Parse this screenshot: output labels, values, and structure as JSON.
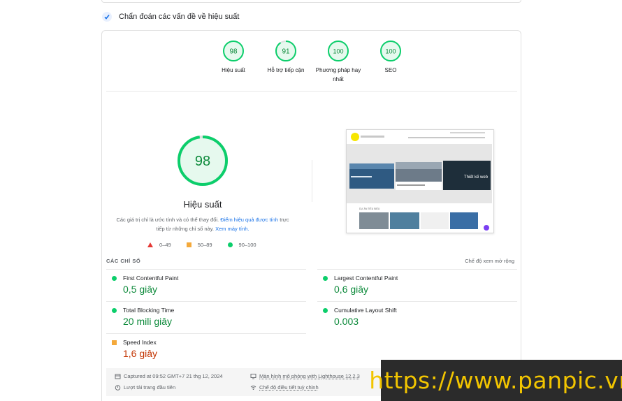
{
  "section": {
    "title": "Chẩn đoán các vấn đề về hiệu suất",
    "icon": "speed-check-icon"
  },
  "gauges": [
    {
      "score": "98",
      "label": "Hiệu suất"
    },
    {
      "score": "91",
      "label": "Hỗ trợ tiếp cận"
    },
    {
      "score": "100",
      "label": "Phương pháp hay nhất"
    },
    {
      "score": "100",
      "label": "SEO"
    }
  ],
  "performance": {
    "score": "98",
    "title": "Hiệu suất",
    "note_before": "Các giá trị chỉ là ước tính và có thể thay đổi. ",
    "note_link1": "Điểm hiệu quả được tính",
    "note_middle": " trực tiếp từ những chỉ số này. ",
    "note_link2": "Xem máy tính."
  },
  "legend": {
    "fail": "0–49",
    "average": "50–89",
    "pass": "90–100"
  },
  "metrics": {
    "title": "CÁC CHỈ SỐ",
    "toggle": "Chế độ xem mở rộng",
    "items": [
      {
        "name": "First Contentful Paint",
        "value": "0,5 giây",
        "status": "green"
      },
      {
        "name": "Largest Contentful Paint",
        "value": "0,6 giây",
        "status": "green"
      },
      {
        "name": "Total Blocking Time",
        "value": "20 mili giây",
        "status": "green"
      },
      {
        "name": "Cumulative Layout Shift",
        "value": "0.003",
        "status": "green"
      },
      {
        "name": "Speed Index",
        "value": "1,6 giây",
        "status": "orange"
      }
    ]
  },
  "footer": {
    "captured": "Captured at 09:52 GMT+7 21 thg 12, 2024",
    "device": "Màn hình mô phỏng with Lighthouse 12.2.3",
    "load": "Lượt tải trang đầu tiên",
    "throttle": "Chế độ điều tiết tuỳ chỉnh"
  },
  "screenshot": {
    "hero_text": "Thiết kế web",
    "section_label": "DỰ ÁN TIÊU BIỂU"
  },
  "watermark": "https://www.panpic.vn",
  "colors": {
    "pass": "#0cce6b",
    "pass_text": "#0d8a3b",
    "average": "#f4a93b",
    "average_text": "#c33300",
    "fail": "#e53935",
    "link": "#1a73e8"
  }
}
